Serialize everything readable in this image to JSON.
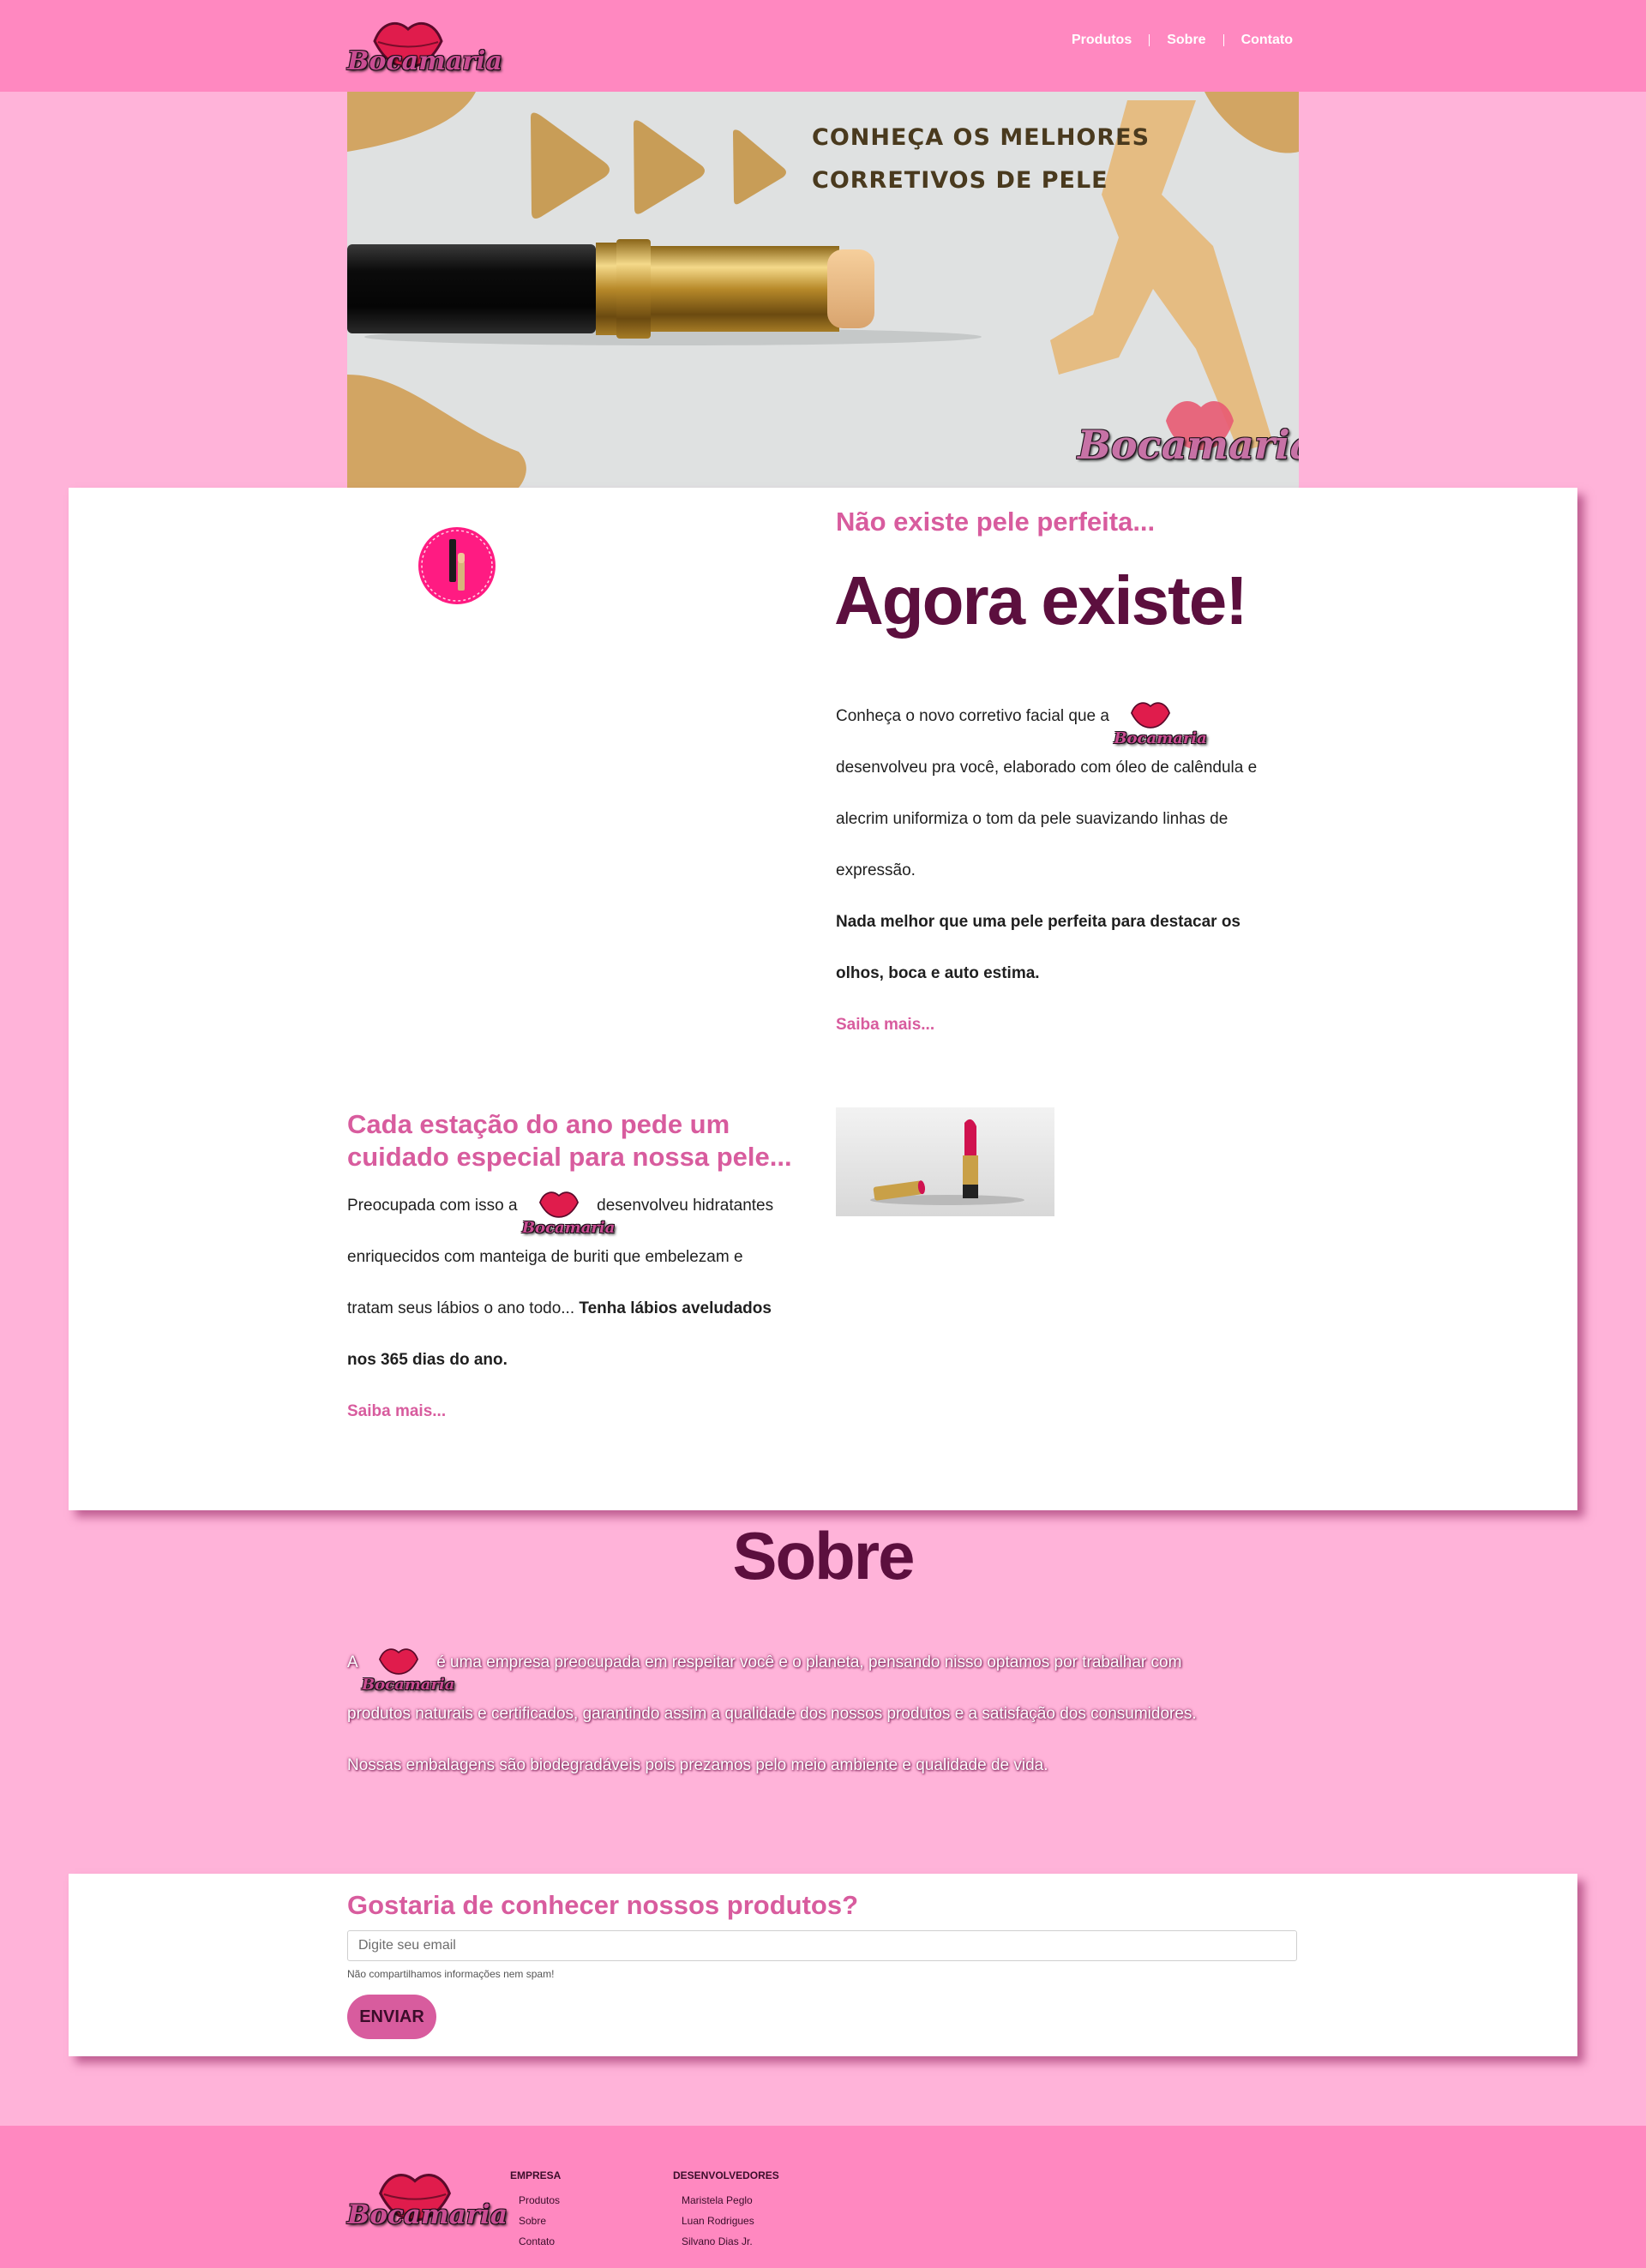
{
  "header": {
    "logo_text": "Bocamaria",
    "nav": [
      "Produtos",
      "Sobre",
      "Contato"
    ]
  },
  "banner": {
    "line1": "CONHEÇA OS MELHORES",
    "line2": "CORRETIVOS DE PELE",
    "logo_text": "Bocamaria"
  },
  "intro": {
    "subtitle": "Não existe pele perfeita...",
    "title": "Agora existe!",
    "text_before_logo": "Conheça o novo corretivo facial que a",
    "logo_text": "Bocamaria",
    "lines": [
      "desenvolveu pra você, elaborado com óleo de calêndula e",
      "alecrim uniformiza o tom da pele suavizando linhas de",
      "expressão."
    ],
    "bold_lines": [
      "Nada melhor que uma pele perfeita para destacar os",
      "olhos, boca e auto estima."
    ],
    "more": "Saiba mais..."
  },
  "lips": {
    "title_line1": "Cada estação do ano pede um",
    "title_line2": "cuidado especial para nossa pele...",
    "text_before_logo": "Preocupada com isso a",
    "logo_text": "Bocamaria",
    "text_after_logo": "desenvolveu hidratantes",
    "line2": "enriquecidos com manteiga de buriti que embelezam e",
    "line3_plain": "tratam seus lábios o ano todo...",
    "line3_bold": "Tenha lábios aveludados",
    "line4_bold": "nos 365 dias do ano.",
    "more": "Saiba mais..."
  },
  "about": {
    "title": "Sobre",
    "prefix": "A",
    "logo_text": "Bocamaria",
    "line1": "é uma empresa preocupada em respeitar você e o planeta, pensando nisso optamos por trabalhar com",
    "line2": "produtos naturais e certificados, garantindo assim a qualidade dos nossos produtos e a satisfação dos consumidores.",
    "line3": "Nossas embalagens são biodegradáveis pois prezamos pelo meio ambiente e qualidade de vida."
  },
  "newsletter": {
    "title": "Gostaria de conhecer nossos produtos?",
    "placeholder": "Digite seu email",
    "note": "Não compartilhamos informações nem spam!",
    "button": "ENVIAR"
  },
  "footer": {
    "logo_text": "Bocamaria",
    "company_title": "EMPRESA",
    "company_links": [
      "Produtos",
      "Sobre",
      "Contato"
    ],
    "dev_title": "DESENVOLVEDORES",
    "devs": [
      "Maristela Peglo",
      "Luan Rodrigues",
      "Silvano Dias Jr."
    ]
  },
  "colors": {
    "background": "#ffb3d9",
    "header": "#ff88c0",
    "accent": "#d85c9e",
    "dark": "#5c0f3e"
  }
}
